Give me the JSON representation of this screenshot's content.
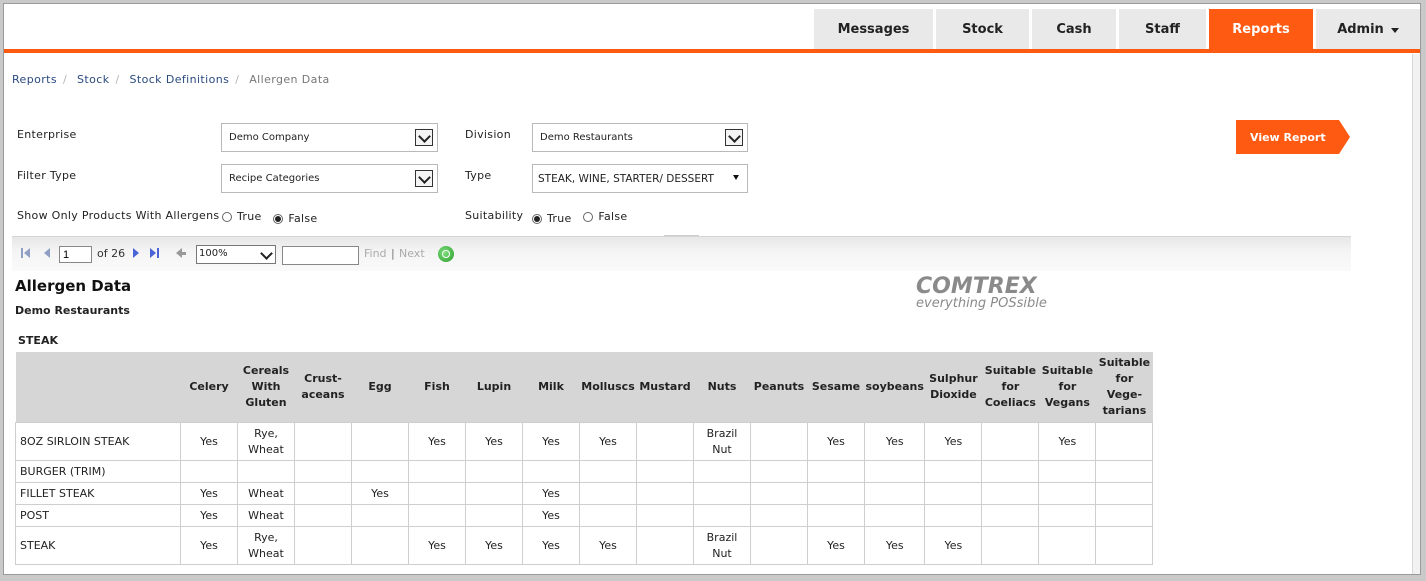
{
  "nav": {
    "tabs": [
      {
        "label": "Messages",
        "active": false
      },
      {
        "label": "Stock",
        "active": false
      },
      {
        "label": "Cash",
        "active": false
      },
      {
        "label": "Staff",
        "active": false
      },
      {
        "label": "Reports",
        "active": true
      },
      {
        "label": "Admin",
        "active": false,
        "dropdown": true
      }
    ],
    "accent_color": "#ff5a12"
  },
  "breadcrumb": [
    "Reports",
    "Stock",
    "Stock Definitions",
    "Allergen Data"
  ],
  "filters": {
    "enterprise": {
      "label": "Enterprise",
      "value": "Demo Company"
    },
    "division": {
      "label": "Division",
      "value": "Demo Restaurants"
    },
    "filter_type": {
      "label": "Filter Type",
      "value": "Recipe Categories"
    },
    "type": {
      "label": "Type",
      "value": "STEAK, WINE, STARTER/ DESSERT"
    },
    "show_only": {
      "label": "Show Only Products With Allergens",
      "options": [
        "True",
        "False"
      ],
      "selected": "False"
    },
    "suitability": {
      "label": "Suitability",
      "options": [
        "True",
        "False"
      ],
      "selected": "True"
    },
    "view_report": "View Report"
  },
  "toolbar": {
    "page": "1",
    "of_pages": "of 26",
    "zoom": "100%",
    "find": "Find",
    "sep": "|",
    "next": "Next"
  },
  "report": {
    "title": "Allergen Data",
    "subtitle": "Demo Restaurants",
    "logo_line1": "COMTREX",
    "logo_line2": "everything POSsible",
    "section": "STEAK",
    "columns": [
      "",
      "Celery",
      "Cereals\nWith\nGluten",
      "Crust-\naceans",
      "Egg",
      "Fish",
      "Lupin",
      "Milk",
      "Molluscs",
      "Mustard",
      "Nuts",
      "Peanuts",
      "Sesame",
      "soybeans",
      "Sulphur\nDioxide",
      "Suitable\nfor\nCoeliacs",
      "Suitable\nfor\nVegans",
      "Suitable\nfor\nVege-\ntarians"
    ],
    "rows": [
      {
        "name": "8OZ SIRLOIN STEAK",
        "cells": [
          "Yes",
          "Rye,\nWheat",
          "",
          "",
          "Yes",
          "Yes",
          "Yes",
          "Yes",
          "",
          "Brazil\nNut",
          "",
          "Yes",
          "Yes",
          "Yes",
          "",
          "Yes",
          ""
        ]
      },
      {
        "name": "BURGER (TRIM)",
        "cells": [
          "",
          "",
          "",
          "",
          "",
          "",
          "",
          "",
          "",
          "",
          "",
          "",
          "",
          "",
          "",
          "",
          ""
        ]
      },
      {
        "name": "FILLET STEAK",
        "cells": [
          "Yes",
          "Wheat",
          "",
          "Yes",
          "",
          "",
          "Yes",
          "",
          "",
          "",
          "",
          "",
          "",
          "",
          "",
          "",
          ""
        ]
      },
      {
        "name": "POST",
        "cells": [
          "Yes",
          "Wheat",
          "",
          "",
          "",
          "",
          "Yes",
          "",
          "",
          "",
          "",
          "",
          "",
          "",
          "",
          "",
          ""
        ]
      },
      {
        "name": "STEAK",
        "cells": [
          "Yes",
          "Rye,\nWheat",
          "",
          "",
          "Yes",
          "Yes",
          "Yes",
          "Yes",
          "",
          "Brazil\nNut",
          "",
          "Yes",
          "Yes",
          "Yes",
          "",
          "",
          ""
        ]
      }
    ]
  }
}
